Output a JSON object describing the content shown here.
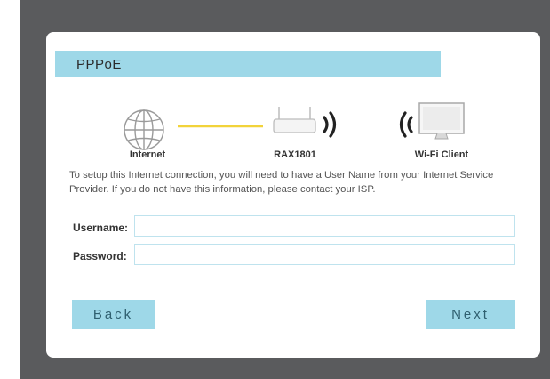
{
  "dialog": {
    "title": "PPPoE",
    "diagram": {
      "internet_label": "Internet",
      "router_label": "RAX1801",
      "client_label": "Wi-Fi Client",
      "icons": [
        "globe-icon",
        "router-icon",
        "wifi-signal-icon",
        "monitor-icon"
      ]
    },
    "description": "To setup this Internet connection, you will need to have a User Name from your Internet Service Provider. If you do not have this information, please contact your ISP.",
    "form": {
      "username_label": "Username:",
      "username_value": "",
      "password_label": "Password:",
      "password_value": ""
    },
    "buttons": {
      "back_label": "Back",
      "next_label": "Next"
    }
  },
  "colors": {
    "accent": "#9ed8e8",
    "link_line": "#f2d33a",
    "backdrop": "#5a5b5d",
    "input_border": "#bfe3ee"
  }
}
